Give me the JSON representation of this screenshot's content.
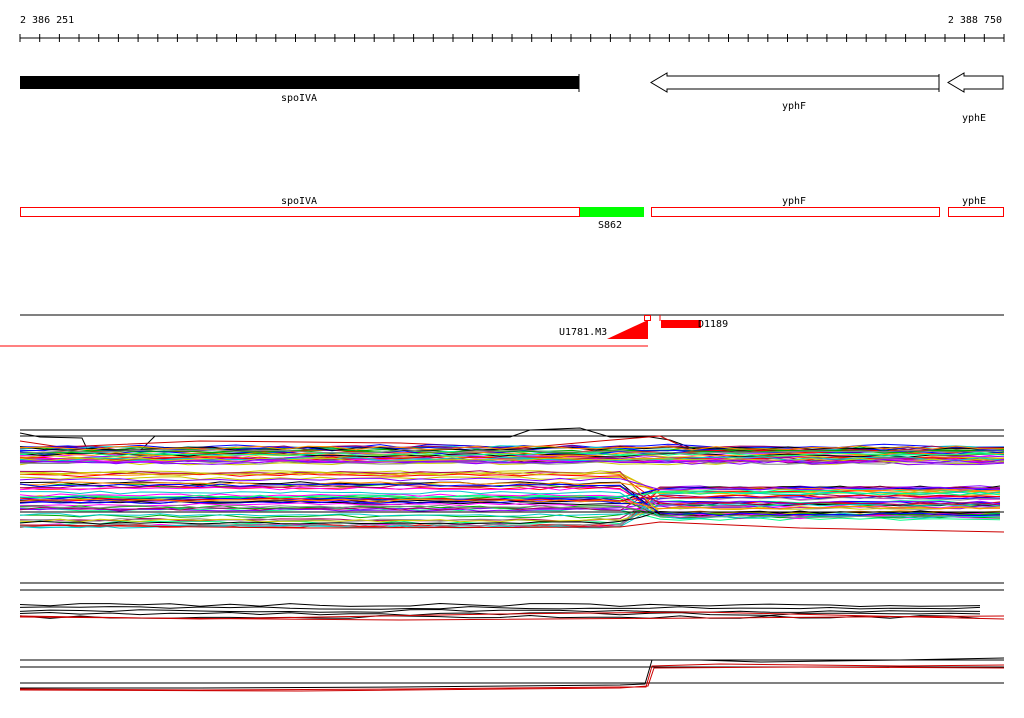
{
  "ruler": {
    "start_label": "2 386 251",
    "end_label": "2 388 750"
  },
  "genes": [
    {
      "name": "spoIVA",
      "strand": "+"
    },
    {
      "name": "yphF",
      "strand": "-"
    },
    {
      "name": "yphE",
      "strand": "-"
    }
  ],
  "transcripts": [
    {
      "name": "spoIVA"
    },
    {
      "name": "S862"
    },
    {
      "name": "yphF"
    },
    {
      "name": "yphE"
    }
  ],
  "features": {
    "upstream_label": "U1781.M3",
    "downstream_label": "D1189"
  },
  "colors": {
    "gene_fill": "#000000",
    "utr_box": "#ff0000",
    "ncrna_fill": "#00ff00",
    "feature_red": "#ff0000",
    "track_line": "#000000"
  }
}
